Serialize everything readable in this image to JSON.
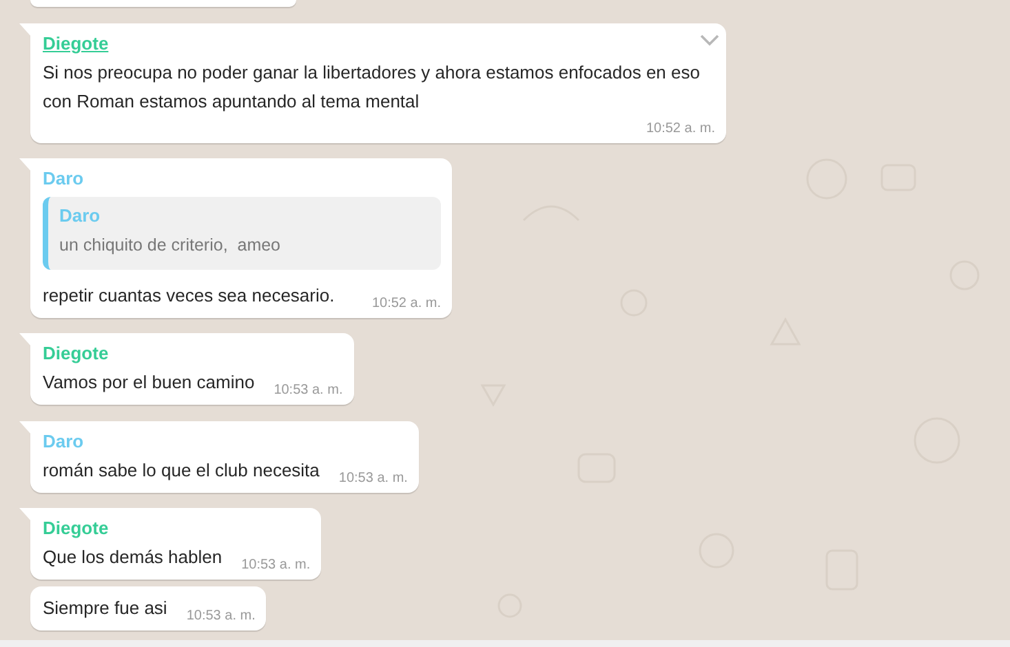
{
  "messages": [
    {
      "kind": "partial"
    },
    {
      "kind": "text",
      "tail": true,
      "hovered": true,
      "sender": {
        "name": "Diegote",
        "color": "#35cd96"
      },
      "text": "Si nos preocupa no poder ganar la libertadores y ahora estamos enfocados en eso con Roman estamos apuntando al tema mental",
      "time": "10:52 a. m."
    },
    {
      "kind": "reply",
      "tail": true,
      "hovered": false,
      "sender": {
        "name": "Daro",
        "color": "#6bcbef"
      },
      "quote": {
        "name": "Daro",
        "color": "#6bcbef",
        "text": "un chiquito de criterio,  ameo"
      },
      "text": "repetir cuantas veces sea necesario.",
      "time": "10:52 a. m."
    },
    {
      "kind": "text",
      "tail": true,
      "hovered": false,
      "sender": {
        "name": "Diegote",
        "color": "#35cd96"
      },
      "text": "Vamos por el buen camino",
      "time": "10:53 a. m."
    },
    {
      "kind": "text",
      "tail": true,
      "hovered": false,
      "sender": {
        "name": "Daro",
        "color": "#6bcbef"
      },
      "text": "román sabe lo que el club necesita",
      "time": "10:53 a. m."
    },
    {
      "kind": "text",
      "tail": true,
      "hovered": false,
      "sender": {
        "name": "Diegote",
        "color": "#35cd96"
      },
      "text": "Que los demás hablen",
      "time": "10:53 a. m."
    },
    {
      "kind": "text",
      "tail": false,
      "hovered": false,
      "text": "Siempre fue asi",
      "time": "10:53 a. m."
    }
  ]
}
